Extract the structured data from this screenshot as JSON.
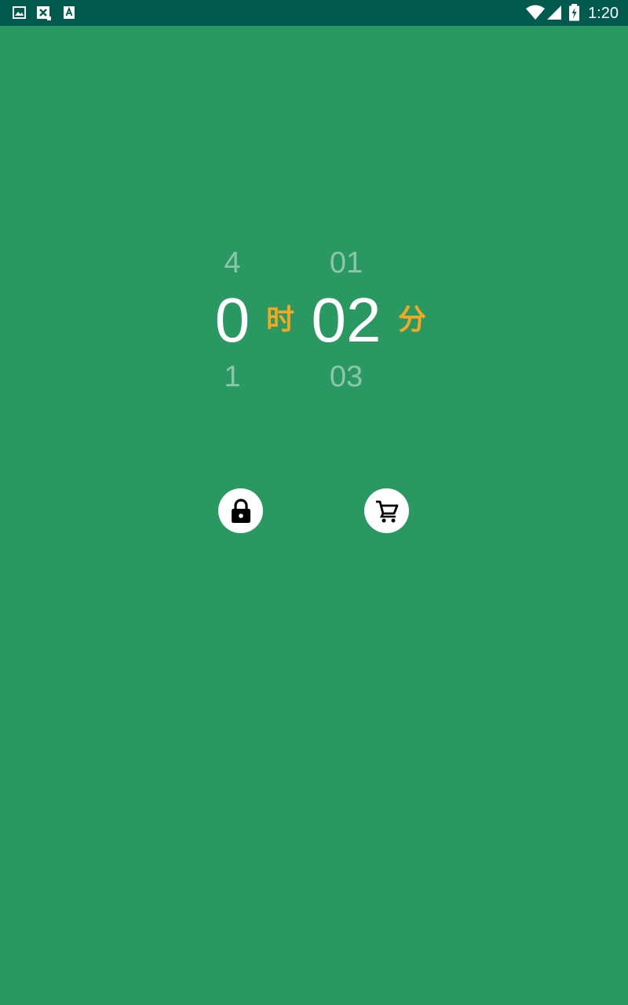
{
  "status_bar": {
    "time": "1:20",
    "left_icons": [
      "image-icon",
      "close-box-icon",
      "text-a-icon"
    ],
    "right_icons": [
      "wifi-icon",
      "signal-icon",
      "battery-charging-icon"
    ]
  },
  "picker": {
    "hours": {
      "prev": "4",
      "current": "0",
      "next": "1",
      "unit": "时"
    },
    "minutes": {
      "prev": "01",
      "current": "02",
      "next": "03",
      "unit": "分"
    }
  },
  "actions": [
    {
      "name": "lock",
      "icon": "lock-icon"
    },
    {
      "name": "cart",
      "icon": "cart-icon"
    }
  ],
  "colors": {
    "background": "#2A9861",
    "status_bar": "#005B4E",
    "unit_accent": "#F5A623",
    "button_bg": "#FFFFFF"
  }
}
